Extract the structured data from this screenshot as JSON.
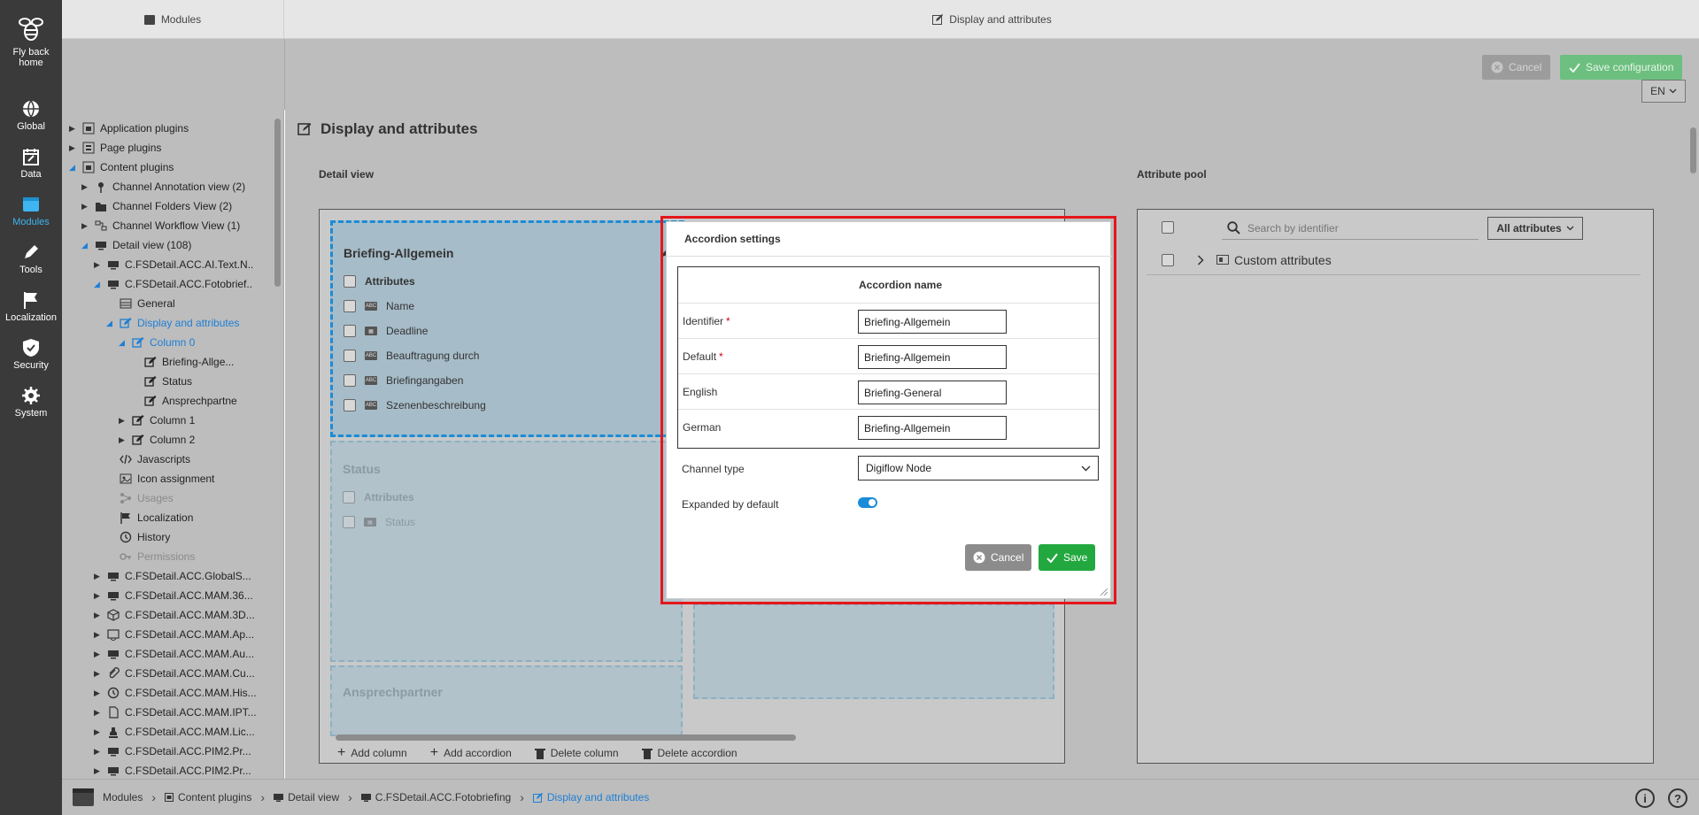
{
  "rail": {
    "items": [
      {
        "label_1": "Fly back",
        "label_2": "home",
        "icon": "bee-icon"
      },
      {
        "label": "Global",
        "icon": "globe-icon"
      },
      {
        "label": "Data",
        "icon": "calendar-edit-icon"
      },
      {
        "label": "Modules",
        "icon": "window-icon"
      },
      {
        "label": "Tools",
        "icon": "pencil-icon"
      },
      {
        "label": "Localization",
        "icon": "flag-icon"
      },
      {
        "label": "Security",
        "icon": "shield-icon"
      },
      {
        "label": "System",
        "icon": "gears-icon"
      }
    ]
  },
  "topbar": {
    "left_title": "Modules",
    "center_title": "Display and attributes"
  },
  "actions": {
    "cancel": "Cancel",
    "save_config": "Save configuration",
    "lang": "EN"
  },
  "tree": {
    "items": [
      {
        "label": "Application plugins"
      },
      {
        "label": "Page plugins"
      },
      {
        "label": "Content plugins"
      },
      {
        "label": "Channel Annotation view (2)"
      },
      {
        "label": "Channel Folders View (2)"
      },
      {
        "label": "Channel Workflow View (1)"
      },
      {
        "label": "Detail view (108)"
      },
      {
        "label": "C.FSDetail.ACC.AI.Text.N.."
      },
      {
        "label": "C.FSDetail.ACC.Fotobrief.."
      },
      {
        "label": "General"
      },
      {
        "label": "Display and attributes"
      },
      {
        "label": "Column 0"
      },
      {
        "label": "Briefing-Allge..."
      },
      {
        "label": "Status"
      },
      {
        "label": "Ansprechpartne"
      },
      {
        "label": "Column 1"
      },
      {
        "label": "Column 2"
      },
      {
        "label": "Javascripts"
      },
      {
        "label": "Icon assignment"
      },
      {
        "label": "Usages"
      },
      {
        "label": "Localization"
      },
      {
        "label": "History"
      },
      {
        "label": "Permissions"
      },
      {
        "label": "C.FSDetail.ACC.GlobalS..."
      },
      {
        "label": "C.FSDetail.ACC.MAM.36..."
      },
      {
        "label": "C.FSDetail.ACC.MAM.3D..."
      },
      {
        "label": "C.FSDetail.ACC.MAM.Ap..."
      },
      {
        "label": "C.FSDetail.ACC.MAM.Au..."
      },
      {
        "label": "C.FSDetail.ACC.MAM.Cu..."
      },
      {
        "label": "C.FSDetail.ACC.MAM.His..."
      },
      {
        "label": "C.FSDetail.ACC.MAM.IPT..."
      },
      {
        "label": "C.FSDetail.ACC.MAM.Lic..."
      },
      {
        "label": "C.FSDetail.ACC.PIM2.Pr..."
      },
      {
        "label": "C.FSDetail.ACC.PIM2.Pr..."
      }
    ]
  },
  "main": {
    "title": "Display and attributes",
    "detail_label": "Detail view",
    "pool_label": "Attribute pool",
    "accordions": [
      {
        "title": "Briefing-Allgemein",
        "header": "Attributes",
        "rows": [
          "Name",
          "Deadline",
          "Beauftragung durch",
          "Briefingangaben",
          "Szenenbeschreibung"
        ]
      },
      {
        "title": "Status",
        "header": "Attributes",
        "rows": [
          "Status"
        ]
      },
      {
        "title": "Ansprechpartner"
      }
    ],
    "detail_actions": {
      "add_column": "Add column",
      "add_accordion": "Add accordion",
      "delete_column": "Delete column",
      "delete_accordion": "Delete accordion"
    },
    "pool": {
      "search_placeholder": "Search by identifier",
      "filter": "All attributes",
      "group": "Custom attributes"
    }
  },
  "modal": {
    "title": "Accordion settings",
    "column_header": "Accordion name",
    "rows": [
      {
        "label": "Identifier",
        "required": "*",
        "value": "Briefing-Allgemein"
      },
      {
        "label": "Default",
        "required": "*",
        "value": "Briefing-Allgemein"
      },
      {
        "label": "English",
        "value": "Briefing-General"
      },
      {
        "label": "German",
        "value": "Briefing-Allgemein"
      }
    ],
    "channel_type_label": "Channel type",
    "channel_type_value": "Digiflow Node",
    "expanded_label": "Expanded by default",
    "expanded": true,
    "cancel": "Cancel",
    "save": "Save",
    "highlight_color": "#e5161b"
  },
  "breadcrumbs": [
    "Modules",
    "Content plugins",
    "Detail view",
    "C.FSDetail.ACC.Fotobriefing",
    "Display and attributes"
  ]
}
